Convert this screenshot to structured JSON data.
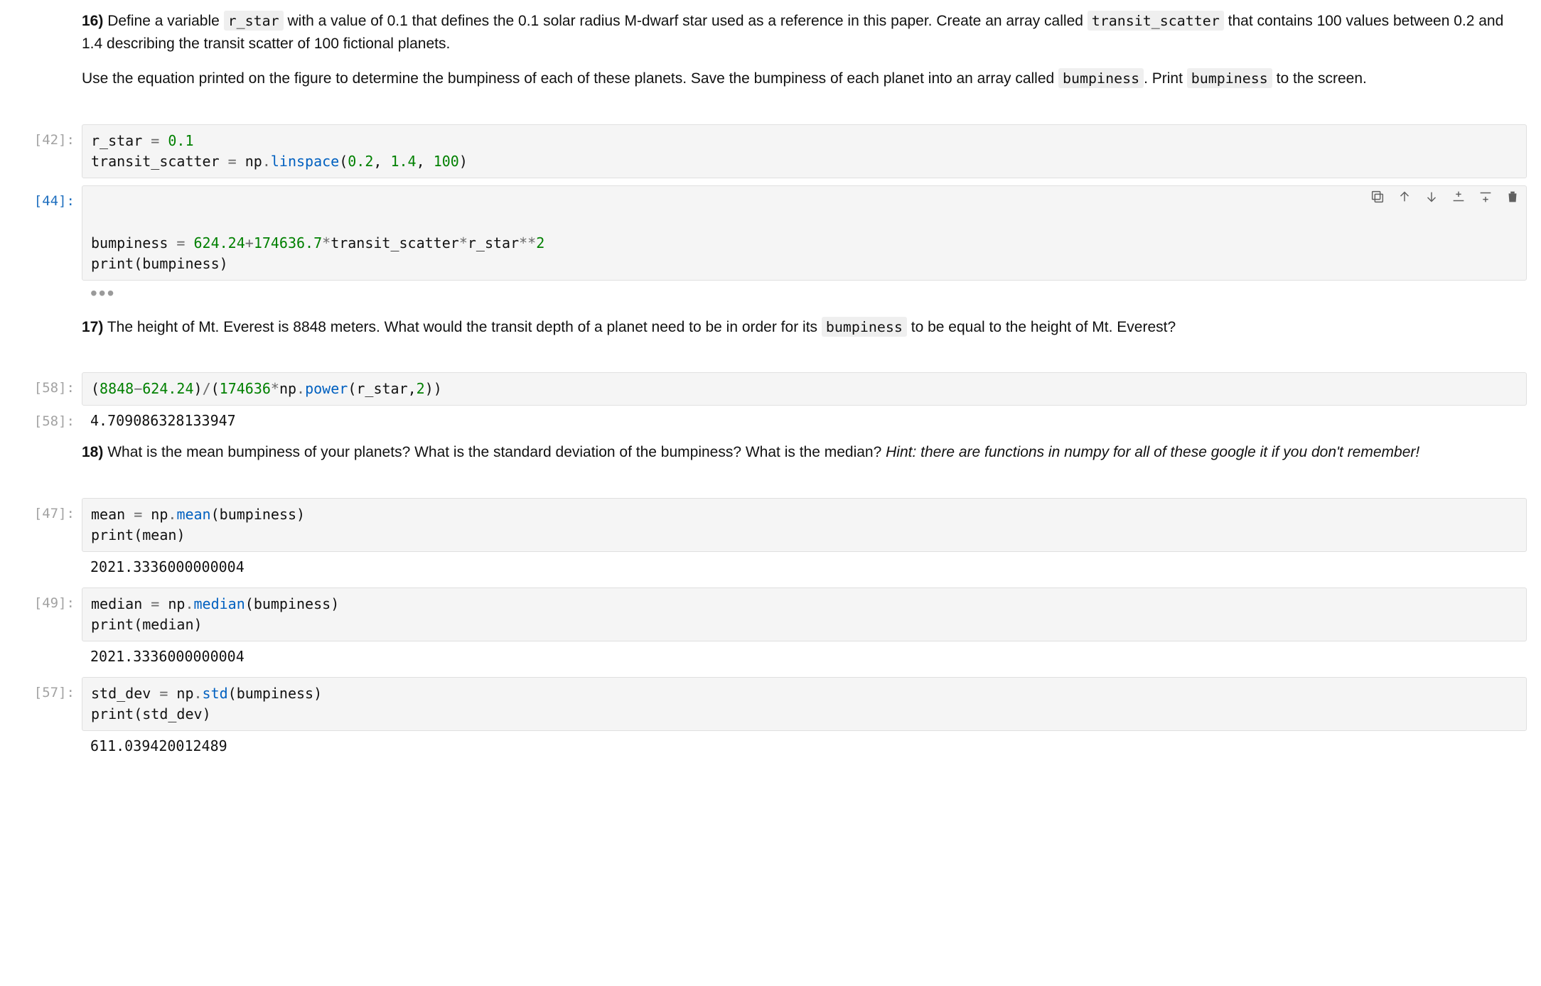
{
  "md16": {
    "lead": "16)",
    "a1": " Define a variable ",
    "code1": "r_star",
    "a2": " with a value of 0.1 that defines the 0.1 solar radius M-dwarf star used as a reference in this paper. Create an array called ",
    "code2": "transit_scatter",
    "a3": " that contains 100 values between 0.2 and 1.4 describing the transit scatter of 100 fictional planets.",
    "b1": "Use the equation printed on the figure to determine the bumpiness of each of these planets. Save the bumpiness of each planet into an array called ",
    "code3": "bumpiness",
    "b2": ". Print ",
    "code4": "bumpiness",
    "b3": " to the screen."
  },
  "cell42": {
    "prompt": "[42]:",
    "l1_a": "r_star ",
    "l1_op": "=",
    "l1_b": " ",
    "l1_num": "0.1",
    "l2_a": "transit_scatter ",
    "l2_op1": "=",
    "l2_b": " np",
    "l2_dot": ".",
    "l2_fn": "linspace",
    "l2_p1": "(",
    "l2_n1": "0.2",
    "l2_c1": ", ",
    "l2_n2": "1.4",
    "l2_c2": ", ",
    "l2_n3": "100",
    "l2_p2": ")"
  },
  "cell44": {
    "prompt": "[44]:",
    "l1_a": "bumpiness ",
    "l1_op1": "=",
    "l1_b": " ",
    "l1_n1": "624.24",
    "l1_plus": "+",
    "l1_n2": "174636.7",
    "l1_m1": "*",
    "l1_c": "transit_scatter",
    "l1_m2": "*",
    "l1_d": "r_star",
    "l1_pow": "**",
    "l1_n3": "2",
    "l2_fn": "print",
    "l2_p1": "(",
    "l2_a": "bumpiness",
    "l2_p2": ")"
  },
  "ellipsis": "•••",
  "md17": {
    "lead": "17)",
    "a1": " The height of Mt. Everest is 8848 meters. What would the transit depth of a planet need to be in order for its ",
    "code1": "bumpiness",
    "a2": " to be equal to the height of Mt. Everest?"
  },
  "cell58": {
    "prompt": "[58]:",
    "p1": "(",
    "n1": "8848",
    "minus": "−",
    "n2": "624.24",
    "p2": ")",
    "div": "/",
    "p3": "(",
    "n3": "174636",
    "m1": "*",
    "np": "np",
    "dot": ".",
    "fn": "power",
    "p4": "(",
    "arg": "r_star",
    "comma": ",",
    "n4": "2",
    "p5": "))"
  },
  "out58": {
    "prompt": "[58]:",
    "value": "4.709086328133947"
  },
  "md18": {
    "lead": "18)",
    "a1": " What is the mean bumpiness of your planets? What is the standard deviation of the bumpiness? What is the median? ",
    "hint": "Hint: there are functions in numpy for all of these google it if you don't remember!"
  },
  "cell47": {
    "prompt": "[47]:",
    "l1_a": "mean ",
    "l1_op": "=",
    "l1_b": " np",
    "l1_dot": ".",
    "l1_fn": "mean",
    "l1_p1": "(",
    "l1_arg": "bumpiness",
    "l1_p2": ")",
    "l2_fn": "print",
    "l2_p1": "(",
    "l2_arg": "mean",
    "l2_p2": ")"
  },
  "out47": "2021.3336000000004",
  "cell49": {
    "prompt": "[49]:",
    "l1_a": "median ",
    "l1_op": "=",
    "l1_b": " np",
    "l1_dot": ".",
    "l1_fn": "median",
    "l1_p1": "(",
    "l1_arg": "bumpiness",
    "l1_p2": ")",
    "l2_fn": "print",
    "l2_p1": "(",
    "l2_arg": "median",
    "l2_p2": ")"
  },
  "out49": "2021.3336000000004",
  "cell57": {
    "prompt": "[57]:",
    "l1_a": "std_dev ",
    "l1_op": "=",
    "l1_b": " np",
    "l1_dot": ".",
    "l1_fn": "std",
    "l1_p1": "(",
    "l1_arg": "bumpiness",
    "l1_p2": ")",
    "l2_fn": "print",
    "l2_p1": "(",
    "l2_arg": "std_dev",
    "l2_p2": ")"
  },
  "out57": "611.039420012489"
}
